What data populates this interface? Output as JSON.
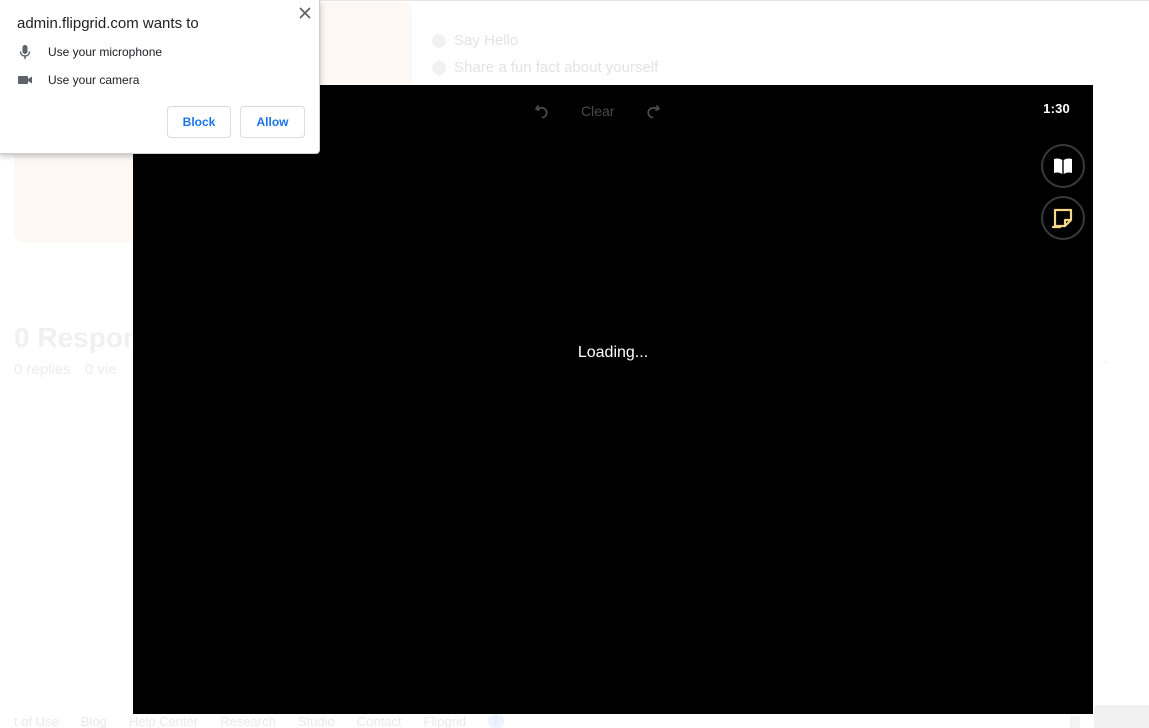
{
  "background": {
    "prompts": [
      "Say Hello",
      "Share a fun fact about yourself"
    ],
    "responses_heading": "0 Respon",
    "stats": [
      "0 replies",
      "0 vie"
    ],
    "side_link": "...",
    "footer_links": [
      "t of Use",
      "Blog",
      "Help Center",
      "Research",
      "Studio",
      "Contact",
      "Flipgrid",
      "+"
    ]
  },
  "permission_popup": {
    "title": "admin.flipgrid.com wants to",
    "permissions": [
      {
        "icon": "microphone-icon",
        "label": "Use your microphone"
      },
      {
        "icon": "camera-icon",
        "label": "Use your camera"
      }
    ],
    "block_label": "Block",
    "allow_label": "Allow",
    "close_icon": "close-icon"
  },
  "recorder": {
    "undo_icon": "undo-icon",
    "clear_label": "Clear",
    "redo_icon": "redo-icon",
    "timer": "1:30",
    "side_buttons": [
      "book-icon",
      "sticky-note-icon"
    ],
    "loading_text": "Loading...",
    "colors": {
      "background": "#000000",
      "sticky_note": "#f5d78a"
    }
  }
}
